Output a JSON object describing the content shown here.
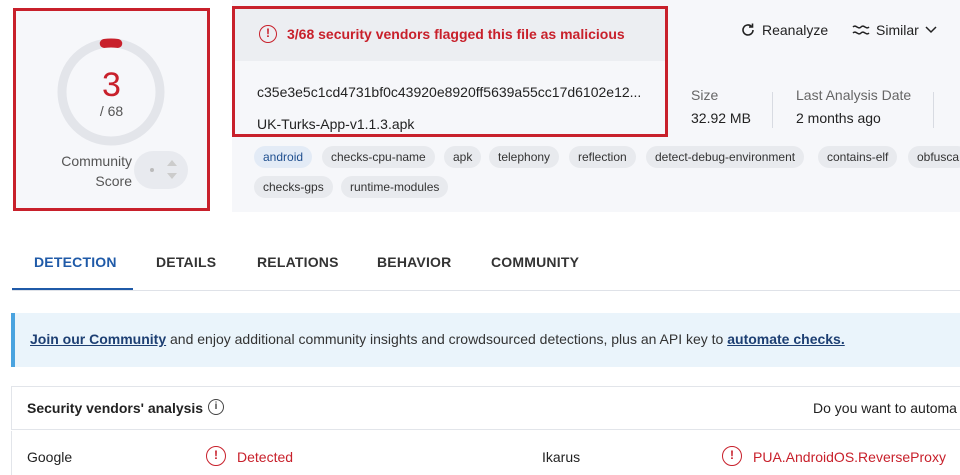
{
  "score": {
    "value": "3",
    "total": "/ 68",
    "community_label": "Community Score",
    "ring_fraction": 0.044
  },
  "alert": {
    "icon": "alert-circle-icon",
    "text": "3/68 security vendors flagged this file as malicious"
  },
  "file": {
    "hash": "c35e3e5c1cd4731bf0c43920e8920ff5639a55cc17d6102e12...",
    "name": "UK-Turks-App-v1.1.3.apk"
  },
  "actions": {
    "reanalyze": "Reanalyze",
    "similar": "Similar"
  },
  "meta": {
    "size_label": "Size",
    "size_value": "32.92 MB",
    "date_label": "Last Analysis Date",
    "date_value": "2 months ago"
  },
  "tags": [
    "android",
    "checks-cpu-name",
    "apk",
    "telephony",
    "reflection",
    "detect-debug-environment",
    "contains-elf",
    "obfusca",
    "checks-gps",
    "runtime-modules"
  ],
  "tabs": [
    "DETECTION",
    "DETAILS",
    "RELATIONS",
    "BEHAVIOR",
    "COMMUNITY"
  ],
  "banner": {
    "link1": "Join our Community",
    "middle": " and enjoy additional community insights and crowdsourced detections, plus an API key to ",
    "link2": "automate checks."
  },
  "vendors": {
    "title": "Security vendors' analysis",
    "automate_question": "Do you want to automa",
    "rows": [
      {
        "vendor": "Google",
        "result": "Detected",
        "vendor2": "Ikarus",
        "result2": "PUA.AndroidOS.ReverseProxy"
      }
    ]
  },
  "colors": {
    "malicious": "#c8202b",
    "accent": "#1f5aa8",
    "banner_border": "#4aa3df"
  }
}
